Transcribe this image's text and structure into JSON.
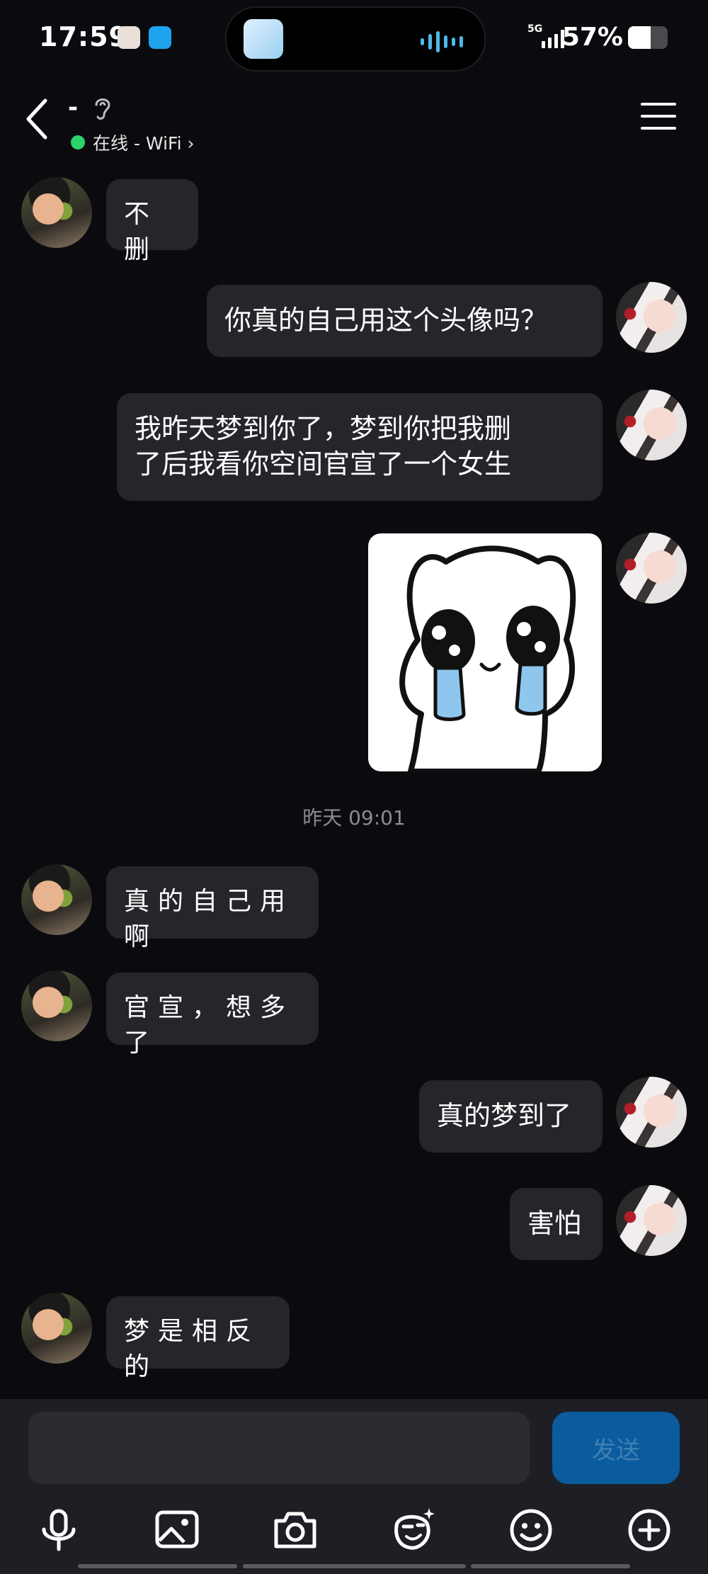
{
  "status_bar": {
    "time": "17:59",
    "network": "5G",
    "battery": "57%",
    "battery_level": 0.57
  },
  "header": {
    "name": "-",
    "status": "在线 - WiFi",
    "status_chevron": "›"
  },
  "messages": [
    {
      "from": "them",
      "text": "不 删"
    },
    {
      "from": "me",
      "text": "你真的自己用这个头像吗？"
    },
    {
      "from": "me",
      "text_lines": [
        "我昨天梦到你了，梦到你把我删",
        "了后我看你空间官宣了一个女生"
      ]
    },
    {
      "from": "me",
      "type": "sticker",
      "sticker": "crying-bear-sticker"
    },
    {
      "from": "them",
      "text": "真的自己用啊"
    },
    {
      "from": "them",
      "text": "官宣，想多了"
    },
    {
      "from": "me",
      "text": "真的梦到了"
    },
    {
      "from": "me",
      "text": "害怕"
    },
    {
      "from": "them",
      "text": "梦是相反的"
    }
  ],
  "timestamp": "昨天 09:01",
  "input": {
    "placeholder": "",
    "send_label": "发送"
  },
  "toolbar": [
    "microphone-icon",
    "image-icon",
    "camera-icon",
    "sticker-icon",
    "emoji-icon",
    "add-icon"
  ],
  "colors": {
    "background": "#0b0b0f",
    "bubble": "#25262b",
    "send": "#0b5c9e",
    "online": "#2bd36a"
  }
}
